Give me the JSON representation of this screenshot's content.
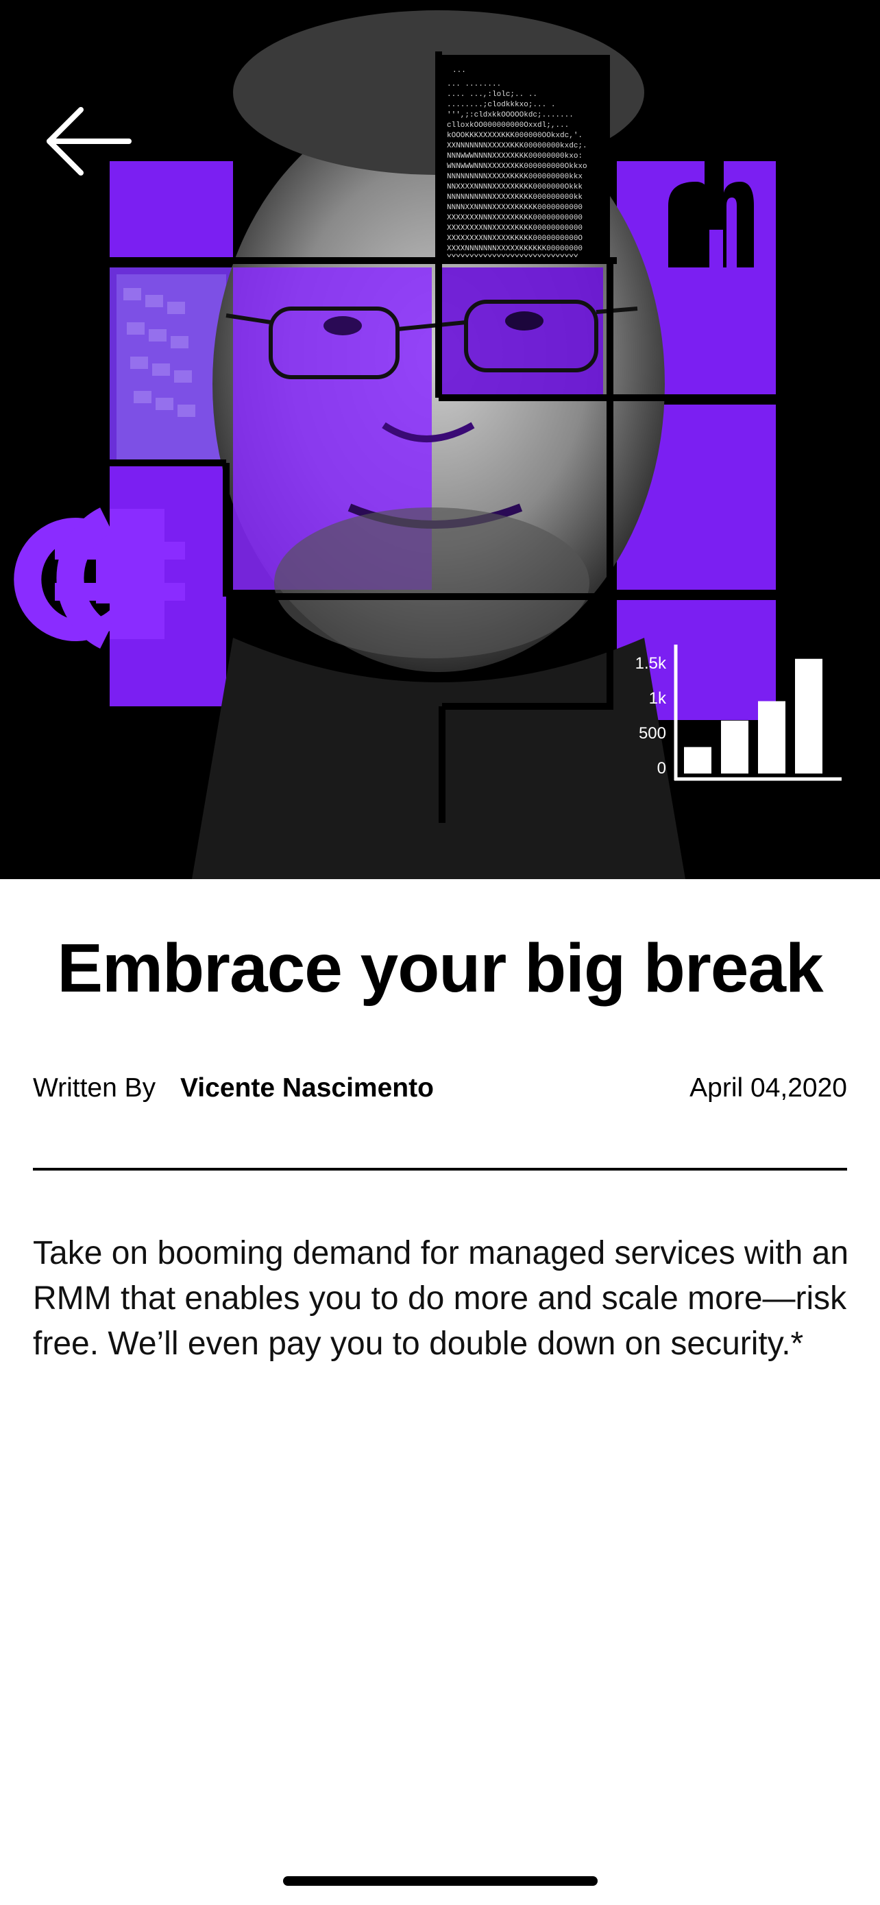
{
  "article": {
    "title": "Embrace your big break",
    "byline_prefix": "Written By",
    "author": "Vicente Nascimento",
    "date": "April 04,2020",
    "body": "Take on booming demand for managed services with an RMM that enables you to do more and scale more—risk free. We’ll even pay you to double down on security.*"
  },
  "hero": {
    "background_color": "#000000",
    "accent_color": "#7B1FF2",
    "chart_ticks": [
      "1.5k",
      "1k",
      "500",
      "0"
    ],
    "chart_bar_values": [
      300,
      600,
      820,
      1300
    ],
    "chart_ymax": 1500,
    "icons": [
      "back-arrow-icon",
      "currency-e-icon",
      "m-logo-icon"
    ]
  },
  "colors": {
    "text": "#000000",
    "divider": "#000000",
    "page_bg": "#ffffff"
  }
}
